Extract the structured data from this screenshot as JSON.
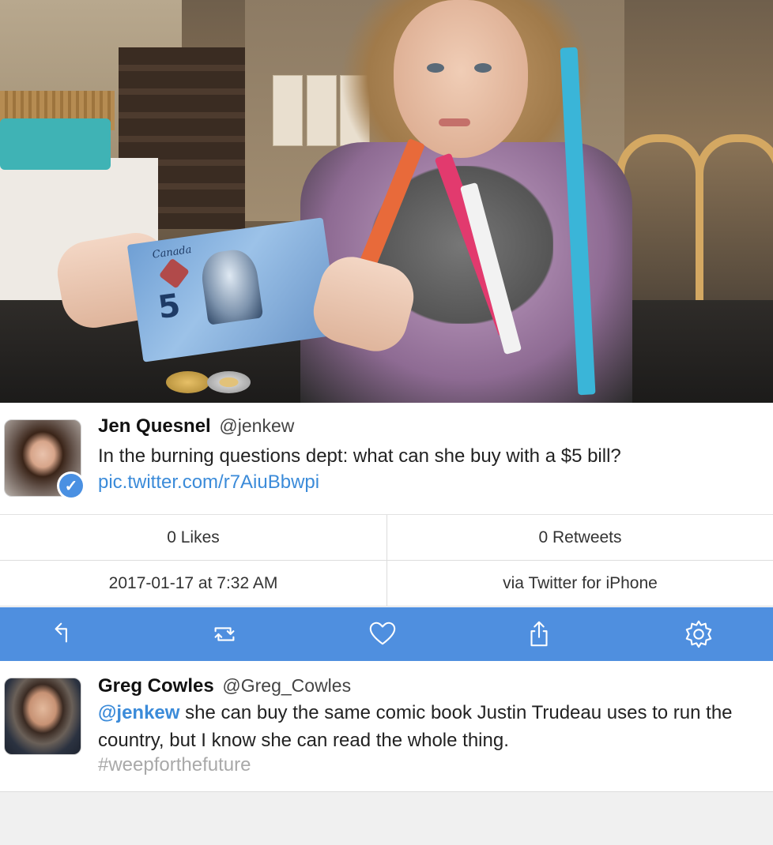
{
  "photo": {
    "banknote_text": "Canada",
    "banknote_value": "5"
  },
  "tweet": {
    "author_name": "Jen Quesnel",
    "author_handle": "@jenkew",
    "text": "In the burning questions dept: what can she buy with a $5 bill?",
    "link": "pic.twitter.com/r7AiuBbwpi",
    "verified_icon": "✓"
  },
  "stats": {
    "likes": "0 Likes",
    "retweets": "0 Retweets",
    "timestamp": "2017-01-17 at 7:32 AM",
    "source": "via Twitter for iPhone"
  },
  "actions": {
    "bar_color": "#4f8fdf",
    "icons": [
      "reply-icon",
      "retweet-icon",
      "like-icon",
      "share-icon",
      "settings-icon"
    ]
  },
  "reply": {
    "author_name": "Greg Cowles",
    "author_handle": "@Greg_Cowles",
    "mention": "@jenkew",
    "text": " she can buy the same comic book Justin Trudeau uses to run the country, but I know she can read the whole thing.",
    "hashtag": "#weepforthefuture"
  },
  "colors": {
    "link": "#3b8bd9",
    "hashtag": "#a9a9a9",
    "verified": "#4a90e2"
  }
}
